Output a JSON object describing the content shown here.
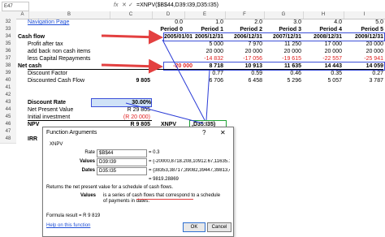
{
  "formula_bar": {
    "name_box": "E47",
    "cancel_icon": "✕",
    "enter_icon": "✓",
    "fx": "fx",
    "formula": "=XNPV($B$44,D39:I39,D35:I35)"
  },
  "columns": [
    "A",
    "B",
    "C",
    "D",
    "E",
    "F",
    "G",
    "H",
    "I"
  ],
  "rows": [
    "32",
    "33",
    "34",
    "35",
    "36",
    "37",
    "38",
    "39",
    "40",
    "41",
    "42",
    "43",
    "44",
    "45",
    "46",
    "47",
    "48"
  ],
  "nav_link": "Navigation Page",
  "periods_top": [
    "0.0",
    "1.0",
    "2.0",
    "3.0",
    "4.0",
    "5.0"
  ],
  "periods": [
    "Period 0",
    "Period 1",
    "Period 2",
    "Period 3",
    "Period 4",
    "Period 5"
  ],
  "labels": {
    "cash_flow": "Cash flow",
    "profit": "Profit after tax",
    "addback": "add back non cash items",
    "lesscap": "less Capital Repayments",
    "netcash": "Net cash",
    "discount_factor": "Discount Factor",
    "dcf": "Discounted Cash Flow",
    "discount_rate": "Discount Rate",
    "npv_value": "Net Present Value",
    "initial": "Initial investment",
    "npv": "NPV",
    "irr": "IRR",
    "xnpv": "XNPV"
  },
  "dates": [
    "2005/01/01",
    "2005/12/31",
    "2006/12/31",
    "2007/12/31",
    "2008/12/31",
    "2009/12/31"
  ],
  "profit": [
    "",
    "5 000",
    "7 970",
    "11 250",
    "17 000",
    "20 000"
  ],
  "addback": [
    "",
    "20 000",
    "20 000",
    "20 000",
    "20 000",
    "20 000"
  ],
  "lesscap": [
    "",
    "-14 832",
    "-17 056",
    "-19 615",
    "-22 557",
    "-25 941"
  ],
  "netcash": [
    "-20 000",
    "8 718",
    "10 913",
    "11 635",
    "14 443",
    "14 059"
  ],
  "discount_factor": [
    "",
    "0.77",
    "0.59",
    "0.46",
    "0.35",
    "0.27"
  ],
  "dcf": [
    "9 805",
    "6 706",
    "6 458",
    "5 296",
    "5 057",
    "3 787"
  ],
  "discount_rate": "30.00%",
  "npv_value": "R 29 805",
  "initial": "(R 20 000)",
  "npv": "R 9 805",
  "xnpv_cell": ",D35:I35)",
  "dialog": {
    "title": "Function Arguments",
    "help_icon": "?",
    "close_icon": "✕",
    "fn": "XNPV",
    "args": [
      {
        "label": "Rate",
        "value": "$B$44",
        "result": "= 0.3"
      },
      {
        "label": "Values",
        "value": "D39:I39",
        "result": "= {-20000,8718.208,10912.67,11635.17,14443.32,14"
      },
      {
        "label": "Dates",
        "value": "D35:I35",
        "result": "= {38353,38717,39082,39447,39813,40178}"
      }
    ],
    "total": "= 9819.28869",
    "description": "Returns the net present value for a schedule of cash flows.",
    "arg_name": "Values",
    "arg_desc": "is a series of cash flows that correspond to a schedule of payments in dates.",
    "formula_result": "Formula result =  R 9 819",
    "help_link": "Help on this function",
    "ok": "OK",
    "cancel": "Cancel"
  }
}
